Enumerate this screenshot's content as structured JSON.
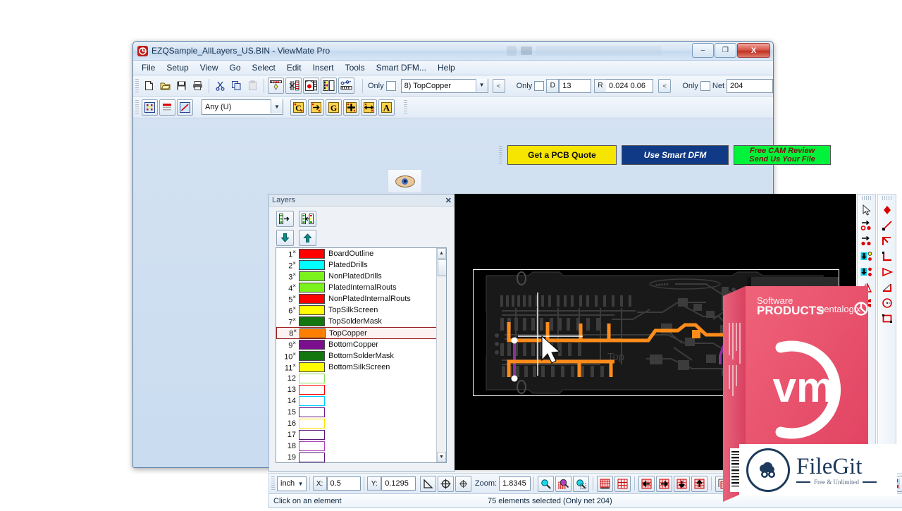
{
  "window": {
    "title": "EZQSample_AllLayers_US.BIN - ViewMate Pro",
    "app_icon": "viewmate-app-icon",
    "minimize_label": "–",
    "maximize_label": "❐",
    "close_label": "X"
  },
  "menu": {
    "items": [
      "File",
      "Setup",
      "View",
      "Go",
      "Select",
      "Edit",
      "Insert",
      "Tools",
      "Smart DFM...",
      "Help"
    ]
  },
  "toolbar_main": {
    "buttons": [
      {
        "name": "new-file-icon",
        "glyph": "὜B"
      },
      {
        "name": "open-file-icon",
        "glyph": "Ὄ2"
      },
      {
        "name": "save-file-icon",
        "glyph": "ὋE"
      },
      {
        "name": "print-icon",
        "glyph": "὚8"
      },
      {
        "name": "cut-icon",
        "glyph": "✂"
      },
      {
        "name": "copy-icon",
        "glyph": "Ὕ0"
      },
      {
        "name": "paste-icon",
        "glyph": "ὌB"
      },
      {
        "name": "highlight-layer-icon",
        "glyph": "☀"
      },
      {
        "name": "measure-icon",
        "glyph": "↕"
      },
      {
        "name": "aperture-icon",
        "glyph": "●"
      },
      {
        "name": "layer-table-icon",
        "glyph": "▤"
      },
      {
        "name": "netlist-icon",
        "glyph": "⧉"
      }
    ]
  },
  "layer_selector": {
    "only_label": "Only",
    "only_checked": false,
    "value": "8) TopCopper",
    "prev_label": "<"
  },
  "dcode_selector": {
    "only_label": "Only",
    "only_checked": false,
    "tag": "D",
    "value": "13",
    "shape_tag": "R",
    "shape_value": "0.024  0.06",
    "prev_label": "<"
  },
  "net_selector": {
    "only_label": "Only",
    "only_checked": false,
    "tag": "Net",
    "value": "204"
  },
  "toolbar_second": {
    "buttons_left": [
      {
        "name": "select-area-icon",
        "glyph": "▦"
      },
      {
        "name": "layer-stack-icon",
        "glyph": "☰"
      },
      {
        "name": "draw-line-icon",
        "glyph": "╱"
      }
    ],
    "filter_combo": "Any    (U)",
    "buttons_right": [
      {
        "name": "copper-select-icon",
        "glyph": "C"
      },
      {
        "name": "move-element-icon",
        "glyph": "⇥"
      },
      {
        "name": "group-select-icon",
        "glyph": "G"
      },
      {
        "name": "expand-select-icon",
        "glyph": "✚"
      },
      {
        "name": "span-select-icon",
        "glyph": "↔"
      },
      {
        "name": "text-select-icon",
        "glyph": "A"
      }
    ]
  },
  "promo": {
    "quote_label": "Get a PCB Quote",
    "dfm_label": "Use Smart DFM",
    "cam_line1": "Free CAM Review",
    "cam_line2": "Send Us Your File"
  },
  "visibility_toolbar": {
    "eye_icon": "eye-visibility-icon"
  },
  "layers_panel": {
    "title": "Layers",
    "close_label": "✕",
    "tools": [
      {
        "name": "layers-show-one-icon",
        "glyph": "⮞"
      },
      {
        "name": "layers-show-all-icon",
        "glyph": "⬌"
      },
      {
        "name": "layer-move-down-icon",
        "glyph": "⬇"
      },
      {
        "name": "layer-move-up-icon",
        "glyph": "⬆"
      }
    ],
    "rows": [
      {
        "num": "1",
        "star": "×",
        "color": "#ff0000",
        "name": "BoardOutline",
        "filled": true,
        "selected": false
      },
      {
        "num": "2",
        "star": "×",
        "color": "#00ffff",
        "name": "PlatedDrills",
        "filled": true,
        "selected": false
      },
      {
        "num": "3",
        "star": "×",
        "color": "#7cf21c",
        "name": "NonPlatedDrills",
        "filled": true,
        "selected": false
      },
      {
        "num": "4",
        "star": "×",
        "color": "#7cf21c",
        "name": "PlatedInternalRouts",
        "filled": true,
        "selected": false
      },
      {
        "num": "5",
        "star": "×",
        "color": "#ff0000",
        "name": "NonPlatedInternalRouts",
        "filled": true,
        "selected": false
      },
      {
        "num": "6",
        "star": "×",
        "color": "#ffff00",
        "name": "TopSilkScreen",
        "filled": true,
        "selected": false
      },
      {
        "num": "7",
        "star": "×",
        "color": "#13760f",
        "name": "TopSolderMask",
        "filled": true,
        "selected": false
      },
      {
        "num": "8",
        "star": "×",
        "color": "#ff8000",
        "name": "TopCopper",
        "filled": true,
        "selected": true
      },
      {
        "num": "9",
        "star": "×",
        "color": "#7b0f8e",
        "name": "BottomCopper",
        "filled": true,
        "selected": false
      },
      {
        "num": "10",
        "star": "×",
        "color": "#13760f",
        "name": "BottomSolderMask",
        "filled": true,
        "selected": false
      },
      {
        "num": "11",
        "star": "×",
        "color": "#ffff00",
        "name": "BottomSilkScreen",
        "filled": true,
        "selected": false
      },
      {
        "num": "12",
        "star": "",
        "color": "#8ce060",
        "name": "",
        "filled": false,
        "selected": false
      },
      {
        "num": "13",
        "star": "",
        "color": "#ff0000",
        "name": "",
        "filled": false,
        "selected": false
      },
      {
        "num": "14",
        "star": "",
        "color": "#00ccff",
        "name": "",
        "filled": false,
        "selected": false
      },
      {
        "num": "15",
        "star": "",
        "color": "#6b1b8a",
        "name": "",
        "filled": false,
        "selected": false
      },
      {
        "num": "16",
        "star": "",
        "color": "#ffe000",
        "name": "",
        "filled": false,
        "selected": false
      },
      {
        "num": "17",
        "star": "",
        "color": "#5a1878",
        "name": "",
        "filled": false,
        "selected": false
      },
      {
        "num": "18",
        "star": "",
        "color": "#b040c0",
        "name": "",
        "filled": false,
        "selected": false
      },
      {
        "num": "19",
        "star": "",
        "color": "#5a1878",
        "name": "",
        "filled": false,
        "selected": false
      }
    ]
  },
  "canvas": {
    "background": "#000000",
    "board_outline_color": "#ffffff",
    "top_copper_color": "#ff8c1a",
    "bottom_copper_color": "#8e2f9e",
    "pad_color": "#3a3a3a",
    "highlight_node_color": "#ffffff",
    "silkscreen_text_top": "Top",
    "cursor": "crosshair-pointer"
  },
  "right_toolbar_a": {
    "buttons": [
      {
        "name": "pointer-select-icon",
        "glyph": "➤"
      },
      {
        "name": "move-to-pad-icon",
        "glyph": "→"
      },
      {
        "name": "copy-pads-icon",
        "glyph": "→"
      },
      {
        "name": "layer-down-pads-icon",
        "glyph": "⬇"
      },
      {
        "name": "layer-up-pads-icon",
        "glyph": "⬇"
      },
      {
        "name": "mirror-horizontal-icon",
        "glyph": "◥"
      },
      {
        "name": "mirror-vertical-icon",
        "glyph": "◢"
      }
    ]
  },
  "right_toolbar_b": {
    "buttons": [
      {
        "name": "draw-flash-icon",
        "glyph": "◆"
      },
      {
        "name": "draw-line-icon",
        "glyph": "╱"
      },
      {
        "name": "draw-polyline-icon",
        "glyph": "⌐"
      },
      {
        "name": "draw-corner-icon",
        "glyph": "∟"
      },
      {
        "name": "draw-triangle-icon",
        "glyph": "▷"
      },
      {
        "name": "draw-arc-icon",
        "glyph": "◺"
      },
      {
        "name": "draw-circle-icon",
        "glyph": "⊙"
      },
      {
        "name": "draw-rectangle-icon",
        "glyph": "▭"
      }
    ]
  },
  "bottom_toolbar": {
    "unit": "inch",
    "x_tag": "X:",
    "x_value": "0.5",
    "y_tag": "Y:",
    "y_value": "0.1295",
    "angle_icon": "angle-measure-icon",
    "origin_icon": "set-origin-icon",
    "datum_icon": "datum-point-icon",
    "zoom_label": "Zoom:",
    "zoom_value": "1.8345",
    "buttons": [
      {
        "name": "zoom-window-icon",
        "glyph": "ὐD"
      },
      {
        "name": "zoom-all-icon",
        "glyph": "ὐE"
      },
      {
        "name": "zoom-previous-icon",
        "glyph": "ὐD"
      },
      {
        "name": "fit-page-icon",
        "glyph": "▤"
      },
      {
        "name": "grid-toggle-icon",
        "glyph": "▦"
      },
      {
        "name": "pan-left-icon",
        "glyph": "◀"
      },
      {
        "name": "pan-right-icon",
        "glyph": "▶"
      },
      {
        "name": "pan-down-icon",
        "glyph": "▼"
      },
      {
        "name": "pan-up-icon",
        "glyph": "▲"
      },
      {
        "name": "zoom-in-region-icon",
        "glyph": "⊞"
      },
      {
        "name": "zoom-out-region-icon",
        "glyph": "⊟"
      },
      {
        "name": "zoom-selection-icon",
        "glyph": "⌗"
      },
      {
        "name": "measure-distance-icon",
        "glyph": "↗"
      },
      {
        "name": "select-region-icon",
        "glyph": "⬚"
      },
      {
        "name": "view-pads-icon",
        "glyph": "⚫"
      },
      {
        "name": "view-lines-icon",
        "glyph": "☰"
      },
      {
        "name": "view-polygons-icon",
        "glyph": "▬"
      },
      {
        "name": "view-drills-icon",
        "glyph": "●"
      },
      {
        "name": "view-all-icon",
        "glyph": "▣"
      }
    ]
  },
  "status_bar": {
    "hint": "Click on an element",
    "selection": "75 elements selected (Only net 204)"
  },
  "product_box": {
    "heading_small": "Software",
    "heading_large": "PRODUCTS",
    "brand": "pentalogix",
    "logo_text": "vm",
    "box_color": "#e8556e"
  },
  "watermark": {
    "name": "FileGit",
    "tagline": "Free & Unlimited",
    "logo_icon": "filegit-cloud-icon"
  }
}
